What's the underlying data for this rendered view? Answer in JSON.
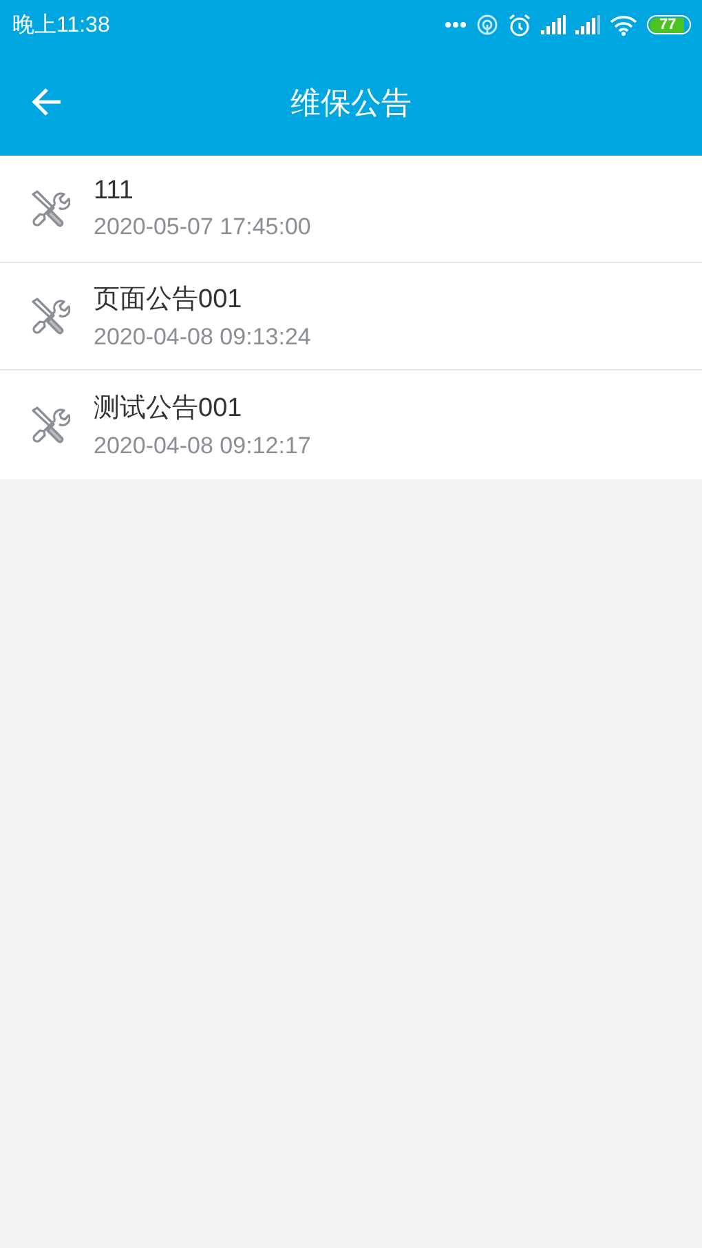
{
  "status_bar": {
    "time": "晚上11:38",
    "battery": "77"
  },
  "header": {
    "title": "维保公告"
  },
  "notices": [
    {
      "title": "111",
      "time": "2020-05-07 17:45:00"
    },
    {
      "title": "页面公告001",
      "time": "2020-04-08 09:13:24"
    },
    {
      "title": "测试公告001",
      "time": "2020-04-08 09:12:17"
    }
  ]
}
